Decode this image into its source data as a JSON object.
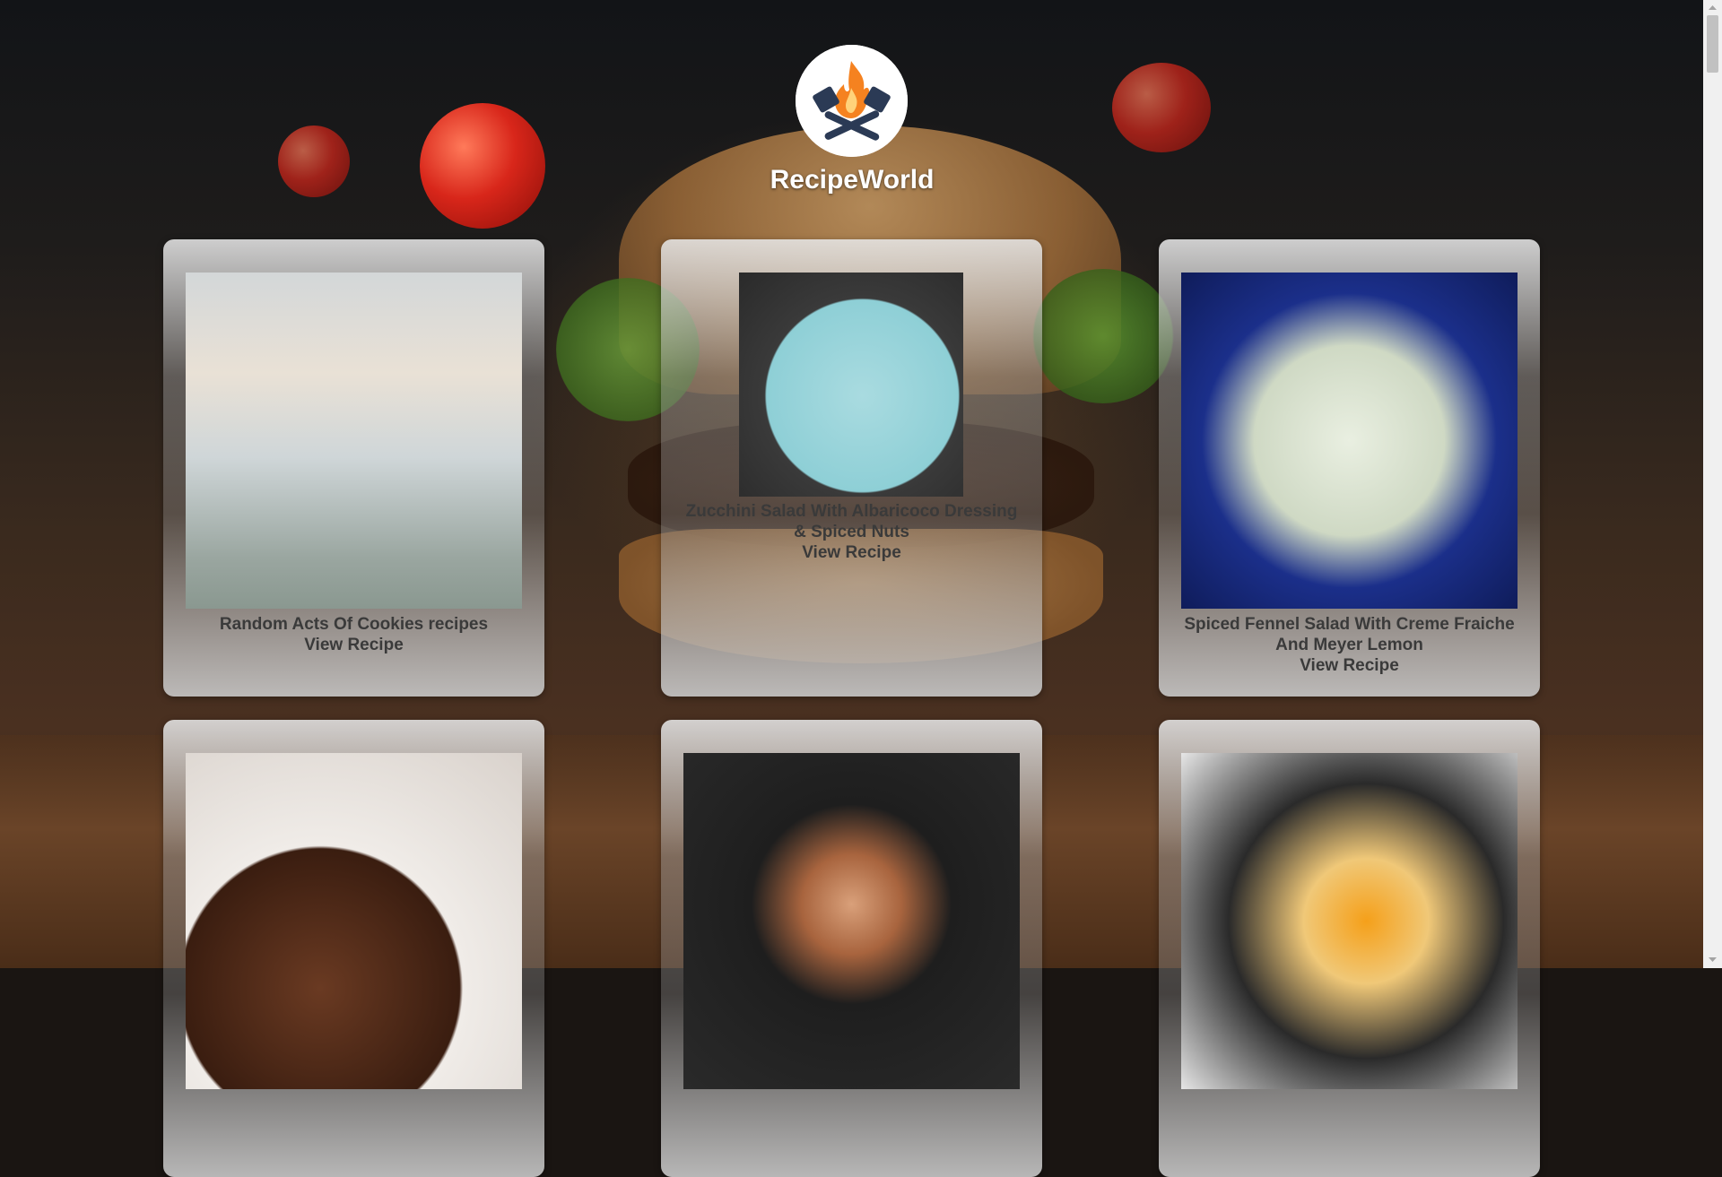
{
  "app": {
    "brand_name": "RecipeWorld",
    "logo_icon": "flame-spatula-logo-icon"
  },
  "colors": {
    "text_dark": "#3a3a3a",
    "brand_text": "#ffffff",
    "logo_flame": "#f58220",
    "logo_tools": "#2b3a55"
  },
  "recipes": [
    {
      "title": "Random Acts Of Cookies recipes",
      "link_label": "View Recipe"
    },
    {
      "title": "Zucchini Salad With Albaricoco Dressing & Spiced Nuts",
      "link_label": "View Recipe"
    },
    {
      "title": "Spiced Fennel Salad With Creme Fraiche And Meyer Lemon",
      "link_label": "View Recipe"
    },
    {
      "title": "",
      "link_label": ""
    },
    {
      "title": "",
      "link_label": ""
    },
    {
      "title": "",
      "link_label": ""
    }
  ]
}
